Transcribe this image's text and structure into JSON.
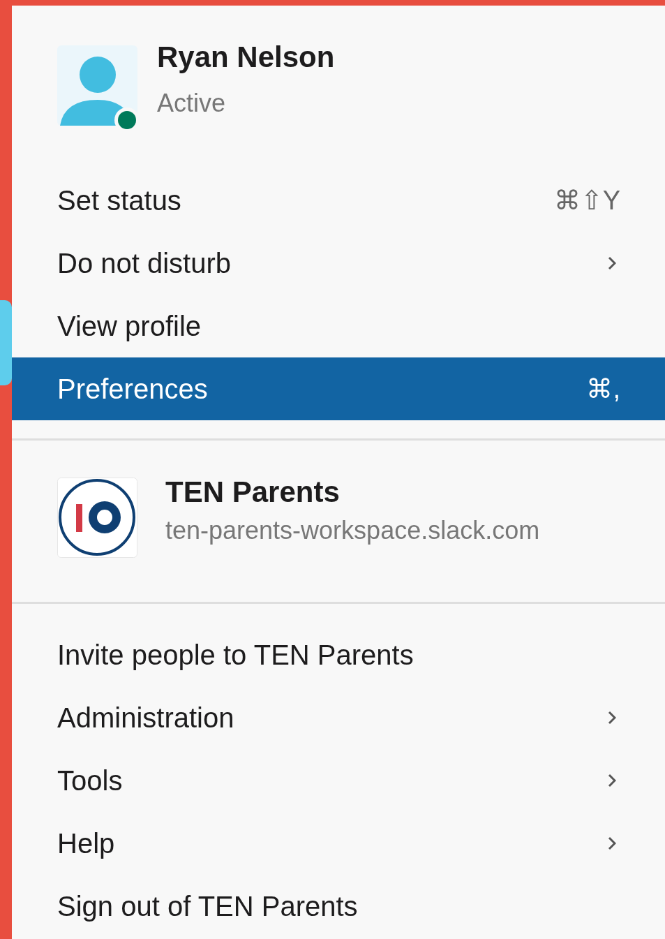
{
  "user": {
    "name": "Ryan Nelson",
    "status": "Active",
    "online": true
  },
  "user_menu": [
    {
      "label": "Set status",
      "shortcut": "⌘⇧Y",
      "submenu": false,
      "selected": false
    },
    {
      "label": "Do not disturb",
      "submenu": true,
      "selected": false
    },
    {
      "label": "View profile",
      "submenu": false,
      "selected": false
    },
    {
      "label": "Preferences",
      "shortcut": "⌘,",
      "submenu": false,
      "selected": true
    }
  ],
  "workspace": {
    "name": "TEN Parents",
    "url": "ten-parents-workspace.slack.com"
  },
  "workspace_menu": [
    {
      "label": "Invite people to TEN Parents",
      "submenu": false,
      "selected": false
    },
    {
      "label": "Administration",
      "submenu": true,
      "selected": false
    },
    {
      "label": "Tools",
      "submenu": true,
      "selected": false
    },
    {
      "label": "Help",
      "submenu": true,
      "selected": false
    },
    {
      "label": "Sign out of TEN Parents",
      "submenu": false,
      "selected": false
    }
  ]
}
